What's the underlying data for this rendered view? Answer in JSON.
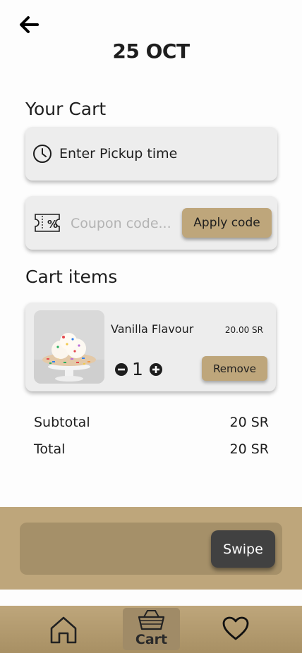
{
  "header": {
    "back_icon": "arrow-left-icon",
    "date": "25 OCT"
  },
  "cart": {
    "title": "Your Cart",
    "pickup": {
      "icon": "clock-icon",
      "label": "Enter Pickup time"
    },
    "coupon": {
      "icon": "coupon-ticket-icon",
      "placeholder": "Coupon code...",
      "value": "",
      "apply_label": "Apply code"
    }
  },
  "items_section": {
    "title": "Cart items",
    "items": [
      {
        "name": "Vanilla Flavour",
        "price": "20.00 SR",
        "quantity": "1",
        "remove_label": "Remove",
        "image": "vanilla-sprinkle-cake-photo"
      }
    ]
  },
  "summary": {
    "subtotal_label": "Subtotal",
    "subtotal_value": "20 SR",
    "total_label": "Total",
    "total_value": "20 SR"
  },
  "swipe": {
    "label": "Swipe"
  },
  "nav": {
    "home_icon": "home-icon",
    "cart_icon": "basket-icon",
    "cart_label": "Cart",
    "favorites_icon": "heart-icon",
    "active": "Cart"
  },
  "colors": {
    "accent": "#bea67b",
    "swipe_track": "#a59069",
    "swipe_button": "#414141",
    "card_bg": "#ededed"
  }
}
